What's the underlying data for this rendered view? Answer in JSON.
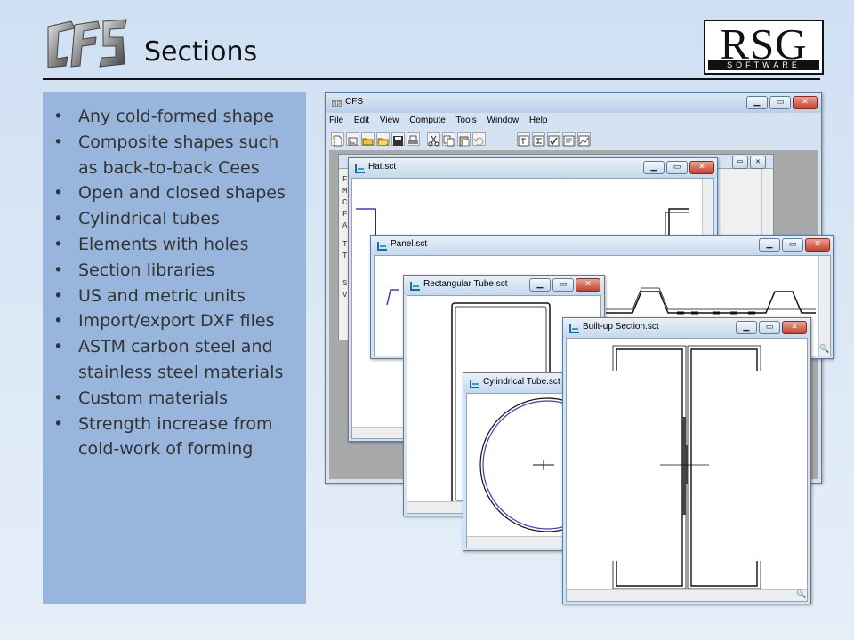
{
  "slide": {
    "title": "Sections",
    "rsg_logo": {
      "big": "RSG",
      "small": "SOFTWARE"
    },
    "bullets": [
      "Any cold-formed shape",
      "Composite shapes such as back-to-back Cees",
      "Open and closed shapes",
      "Cylindrical tubes",
      "Elements with holes",
      "Section libraries",
      "US and metric units",
      "Import/export DXF files",
      "ASTM carbon steel and stainless steel materials",
      "Custom materials",
      "Strength increase from cold-work of forming"
    ],
    "colors": {
      "panel": "#98b6dc",
      "section_blue": "#3b3bd0",
      "section_black": "#111111"
    }
  },
  "app": {
    "title": "CFS",
    "menu": [
      "File",
      "Edit",
      "View",
      "Compute",
      "Tools",
      "Window",
      "Help"
    ],
    "window_controls": [
      "minimize",
      "maximize",
      "close"
    ],
    "toolbar_icons": [
      "new-icon",
      "new-section-icon",
      "open-icon",
      "open-folder-icon",
      "save-icon",
      "print-icon",
      "cut-icon",
      "copy-icon",
      "paste-icon",
      "undo-icon",
      "section-properties-icon",
      "member-check-icon",
      "check-icon",
      "report-icon",
      "graph-icon"
    ],
    "background_doc_lines": [
      "Fi",
      "Ma",
      "Co",
      "Fo",
      "Ac",
      "Te",
      "Te",
      "Sh",
      "Va"
    ]
  },
  "windows": [
    {
      "id": "hat",
      "title": "Hat.sct"
    },
    {
      "id": "panel",
      "title": "Panel.sct"
    },
    {
      "id": "rect",
      "title": "Rectangular Tube.sct"
    },
    {
      "id": "cyl",
      "title": "Cylindrical Tube.sct"
    },
    {
      "id": "built",
      "title": "Built-up Section.sct"
    }
  ]
}
